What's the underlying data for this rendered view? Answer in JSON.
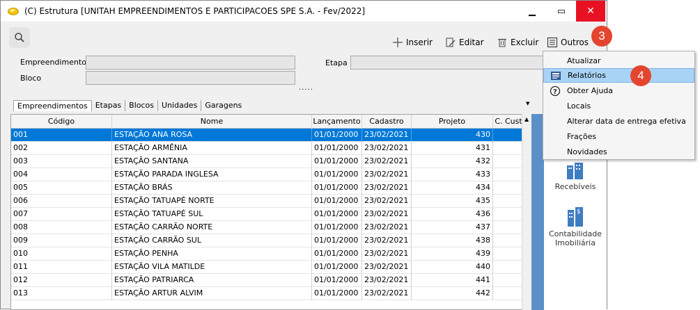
{
  "window": {
    "title": "(C) Estrutura [UNITAH EMPREENDIMENTOS E PARTICIPACOES SPE S.A. - Fev/2022]",
    "minimize": "▁",
    "maximize": "▭",
    "close": "✕"
  },
  "toolbar": {
    "inserir": "Inserir",
    "editar": "Editar",
    "excluir": "Excluir",
    "outros": "Outros"
  },
  "form": {
    "empreendimento_label": "Empreendimento",
    "empreendimento_value": "",
    "bloco_label": "Bloco",
    "bloco_value": "",
    "etapa_label": "Etapa",
    "etapa_value": "",
    "dots": "....."
  },
  "tabs": [
    "Empreendimentos",
    "Etapas",
    "Blocos",
    "Unidades",
    "Garagens"
  ],
  "grid": {
    "columns": [
      "Código",
      "Nome",
      "Lançamento",
      "Cadastro",
      "Projeto",
      "C. Cust"
    ],
    "rows": [
      [
        "001",
        "ESTAÇÃO ANA ROSA",
        "01/01/2000",
        "23/02/2021",
        "430"
      ],
      [
        "002",
        "ESTAÇÃO ARMÊNIA",
        "01/01/2000",
        "23/02/2021",
        "431"
      ],
      [
        "003",
        "ESTAÇÃO SANTANA",
        "01/01/2000",
        "23/02/2021",
        "432"
      ],
      [
        "004",
        "ESTAÇÃO PARADA INGLESA",
        "01/01/2000",
        "23/02/2021",
        "433"
      ],
      [
        "005",
        "ESTAÇÃO BRÁS",
        "01/01/2000",
        "23/02/2021",
        "434"
      ],
      [
        "006",
        "ESTAÇÃO TATUAPÉ NORTE",
        "01/01/2000",
        "23/02/2021",
        "435"
      ],
      [
        "007",
        "ESTAÇÃO TATUAPÉ SUL",
        "01/01/2000",
        "23/02/2021",
        "436"
      ],
      [
        "008",
        "ESTAÇÃO CARRÃO NORTE",
        "01/01/2000",
        "23/02/2021",
        "437"
      ],
      [
        "009",
        "ESTAÇÃO CARRÃO SUL",
        "01/01/2000",
        "23/02/2021",
        "438"
      ],
      [
        "010",
        "ESTAÇÃO PENHA",
        "01/01/2000",
        "23/02/2021",
        "439"
      ],
      [
        "011",
        "ESTAÇÃO VILA  MATILDE",
        "01/01/2000",
        "23/02/2021",
        "440"
      ],
      [
        "012",
        "ESTAÇÃO PATRIARCA",
        "01/01/2000",
        "23/02/2021",
        "441"
      ],
      [
        "013",
        "ESTAÇÃO ARTUR ALVIM",
        "01/01/2000",
        "23/02/2021",
        "442"
      ]
    ]
  },
  "side_modules": {
    "recebiveis": "Recebíveis",
    "contabilidade_line1": "Contabilidade",
    "contabilidade_line2": "Imobiliária"
  },
  "menu": {
    "items": [
      "Atualizar",
      "Relatórios",
      "Obter Ajuda",
      "Locais",
      "Alterar data de entrega efetiva",
      "Frações",
      "Novidades"
    ]
  },
  "callouts": {
    "step3": "3",
    "step4": "4"
  },
  "colors": {
    "selection": "#0078d7",
    "menu_highlight": "#a9d3f5",
    "callout": "#e5452f",
    "close_button": "#e81123"
  }
}
